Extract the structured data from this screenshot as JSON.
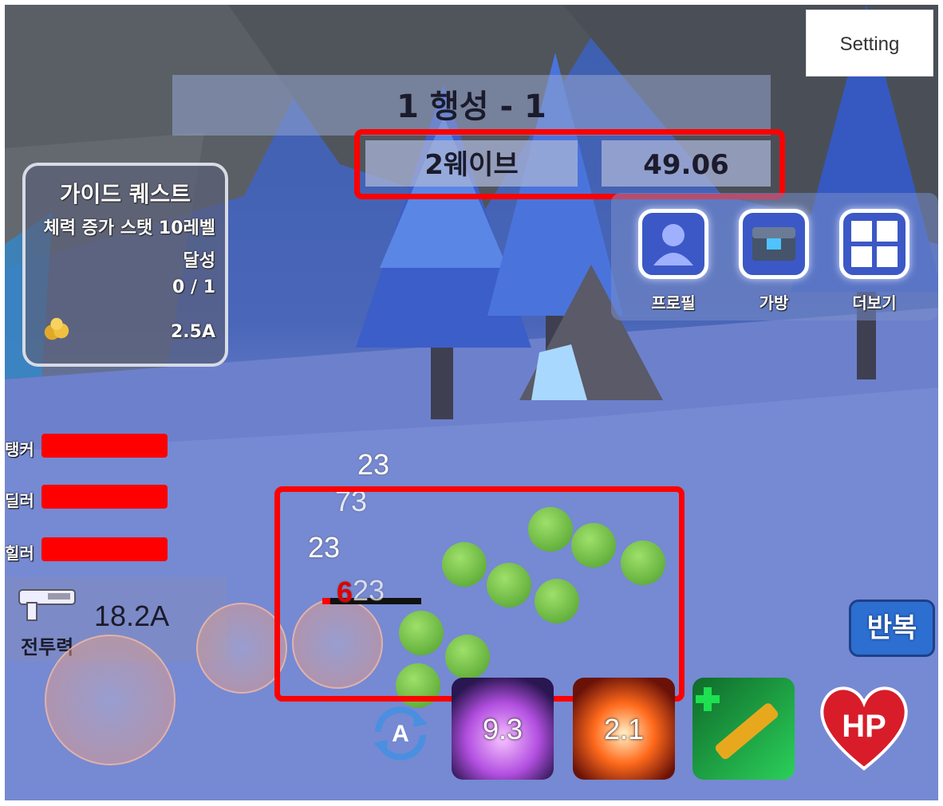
{
  "header": {
    "stage_title": "1 행성 - 1",
    "wave_label": "2웨이브",
    "timer": "49.06"
  },
  "settings_button": {
    "label": "Setting"
  },
  "guide_quest": {
    "title": "가이드 퀘스트",
    "description": "체력 증가 스탯 10레벨 달성",
    "progress": "0 / 1",
    "reward_amount": "2.5A",
    "reward_icon": "gold-nugget-icon"
  },
  "menu": {
    "items": [
      {
        "label": "프로필",
        "icon": "profile-icon"
      },
      {
        "label": "가방",
        "icon": "chest-icon"
      },
      {
        "label": "더보기",
        "icon": "grid-icon"
      }
    ]
  },
  "party": {
    "members": [
      {
        "label": "탱커",
        "hp_fraction": 1.0
      },
      {
        "label": "딜러",
        "hp_fraction": 1.0
      },
      {
        "label": "힐러",
        "hp_fraction": 1.0
      }
    ]
  },
  "combat_power": {
    "value": "18.2A",
    "label": "전투력",
    "icon": "gun-icon"
  },
  "damage_numbers": [
    "23",
    "73",
    "23",
    "23",
    "6"
  ],
  "skills": [
    {
      "name": "purple-vortex-skill",
      "cooldown": "9.3"
    },
    {
      "name": "fire-burst-skill",
      "cooldown": "2.1"
    },
    {
      "name": "cannon-skill",
      "cooldown": ""
    }
  ],
  "auto_button": {
    "icon": "auto-cycle-icon",
    "label": "A"
  },
  "repeat_button": {
    "label": "반복"
  },
  "hp_potion": {
    "label": "HP"
  },
  "colors": {
    "highlight": "#ff0000",
    "hp_bar": "#ff0000",
    "repeat_button": "#2c6fd0"
  }
}
